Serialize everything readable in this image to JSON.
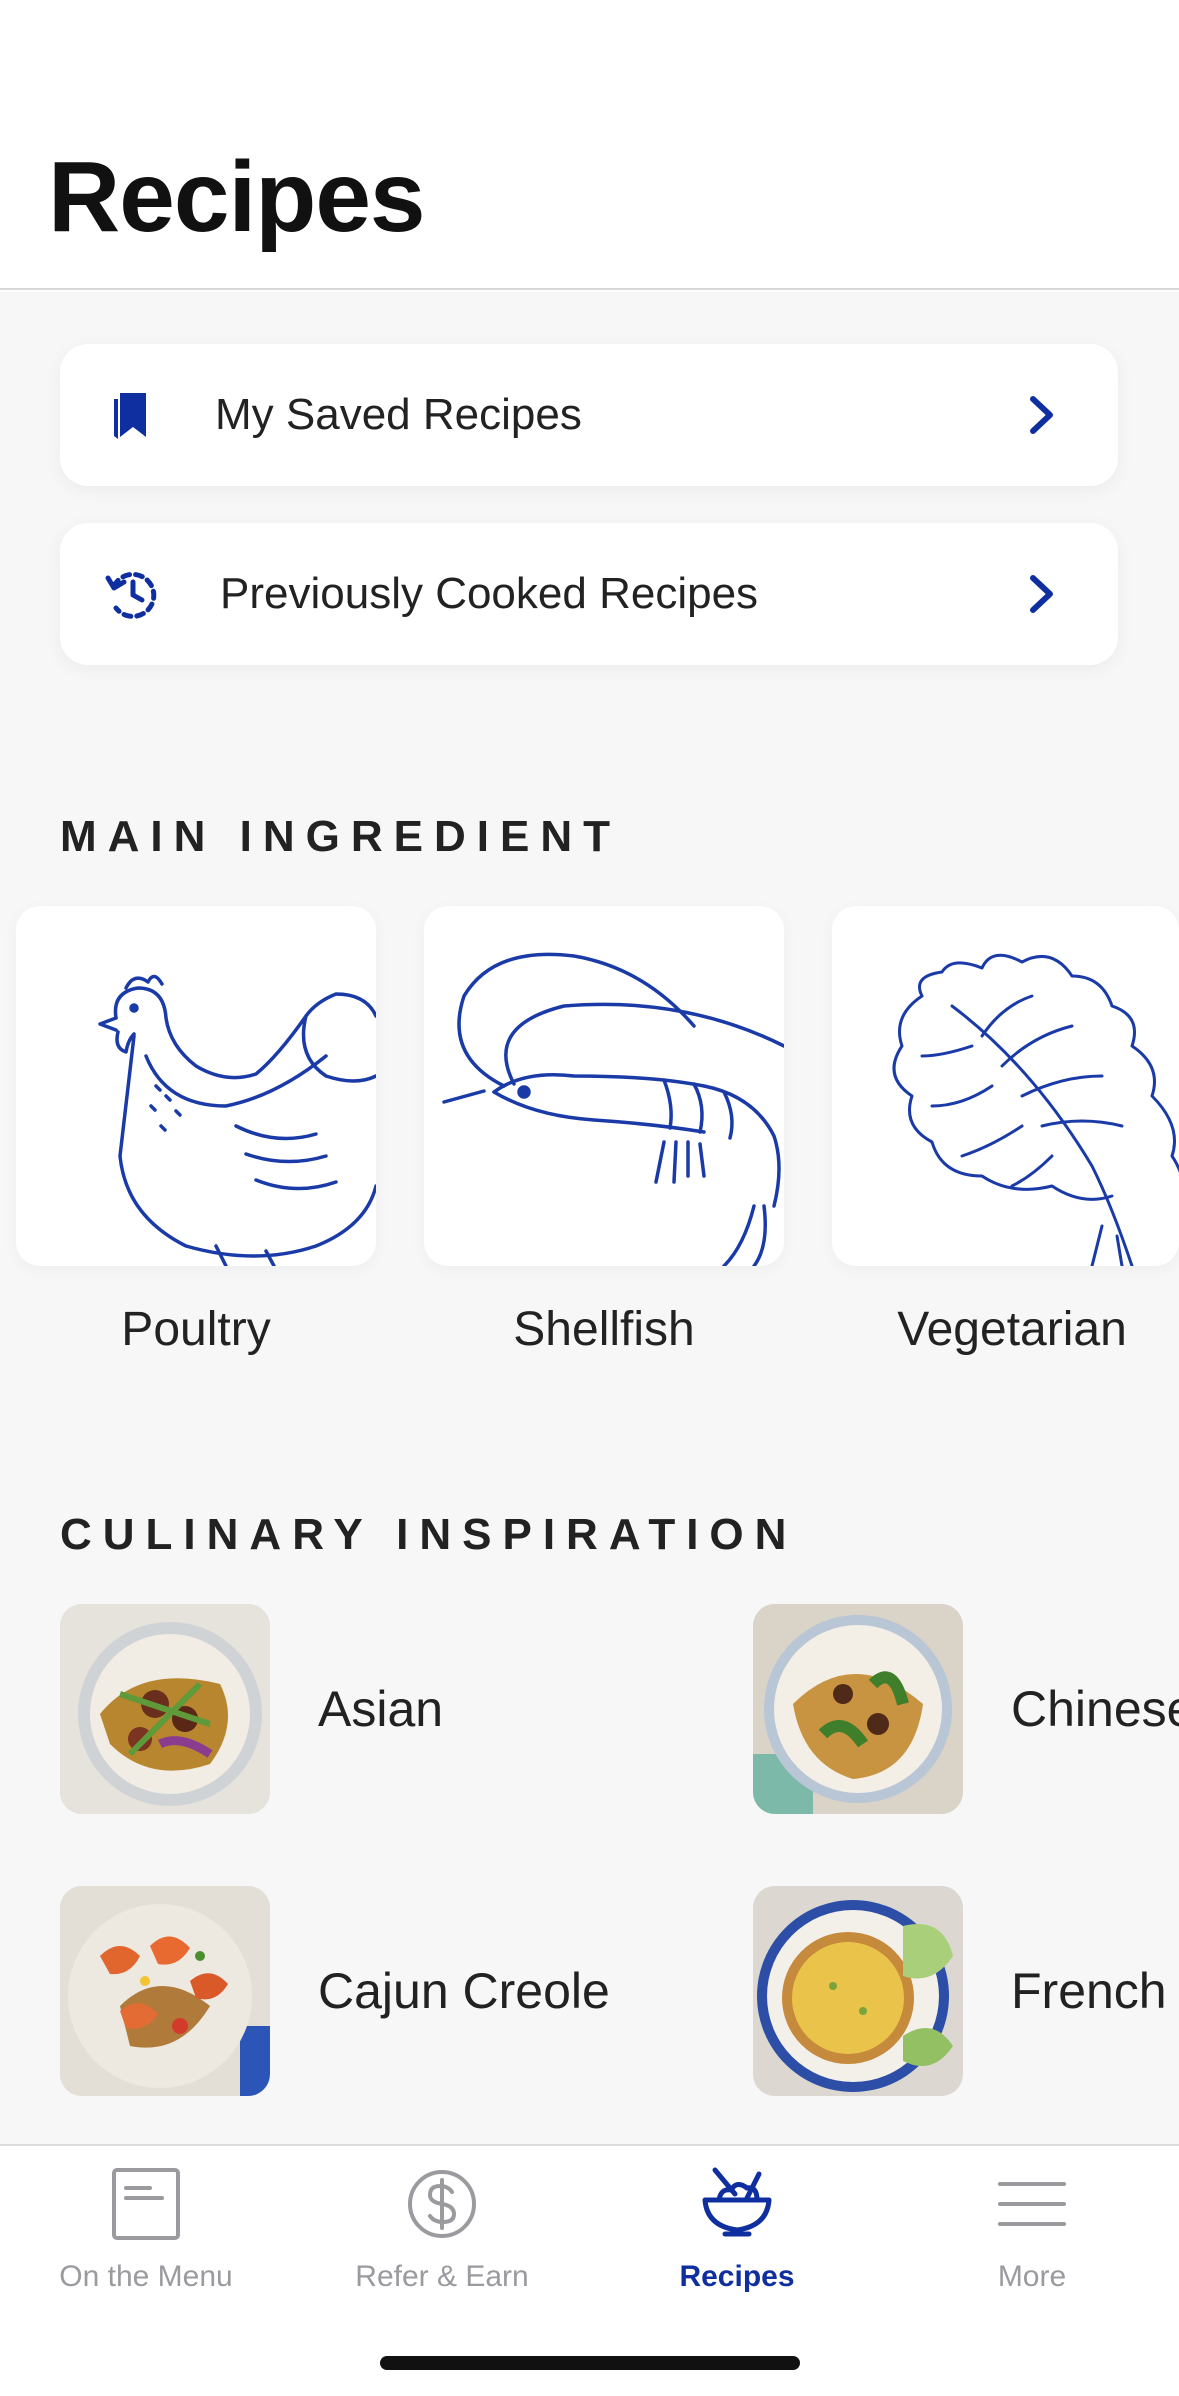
{
  "header": {
    "title": "Recipes"
  },
  "quick_links": [
    {
      "label": "My Saved Recipes",
      "icon": "bookmark-icon"
    },
    {
      "label": "Previously Cooked Recipes",
      "icon": "history-clock-icon"
    }
  ],
  "main_ingredient": {
    "heading": "MAIN INGREDIENT",
    "items": [
      {
        "label": "Poultry",
        "icon": "chicken-illustration"
      },
      {
        "label": "Shellfish",
        "icon": "shrimp-illustration"
      },
      {
        "label": "Vegetarian",
        "icon": "kale-leaf-illustration"
      }
    ]
  },
  "culinary_inspiration": {
    "heading": "CULINARY INSPIRATION",
    "items": [
      {
        "label": "Asian"
      },
      {
        "label": "Chinese"
      },
      {
        "label": "Cajun Creole"
      },
      {
        "label": "French"
      }
    ]
  },
  "tabbar": {
    "tabs": [
      {
        "label": "On the Menu",
        "icon": "menu-card-icon"
      },
      {
        "label": "Refer & Earn",
        "icon": "dollar-circle-icon"
      },
      {
        "label": "Recipes",
        "icon": "bowl-icon",
        "active": true
      },
      {
        "label": "More",
        "icon": "hamburger-icon"
      }
    ]
  },
  "colors": {
    "accent": "#0f2fa0",
    "inactive": "#9a9a9f",
    "background": "#f7f7f8"
  }
}
